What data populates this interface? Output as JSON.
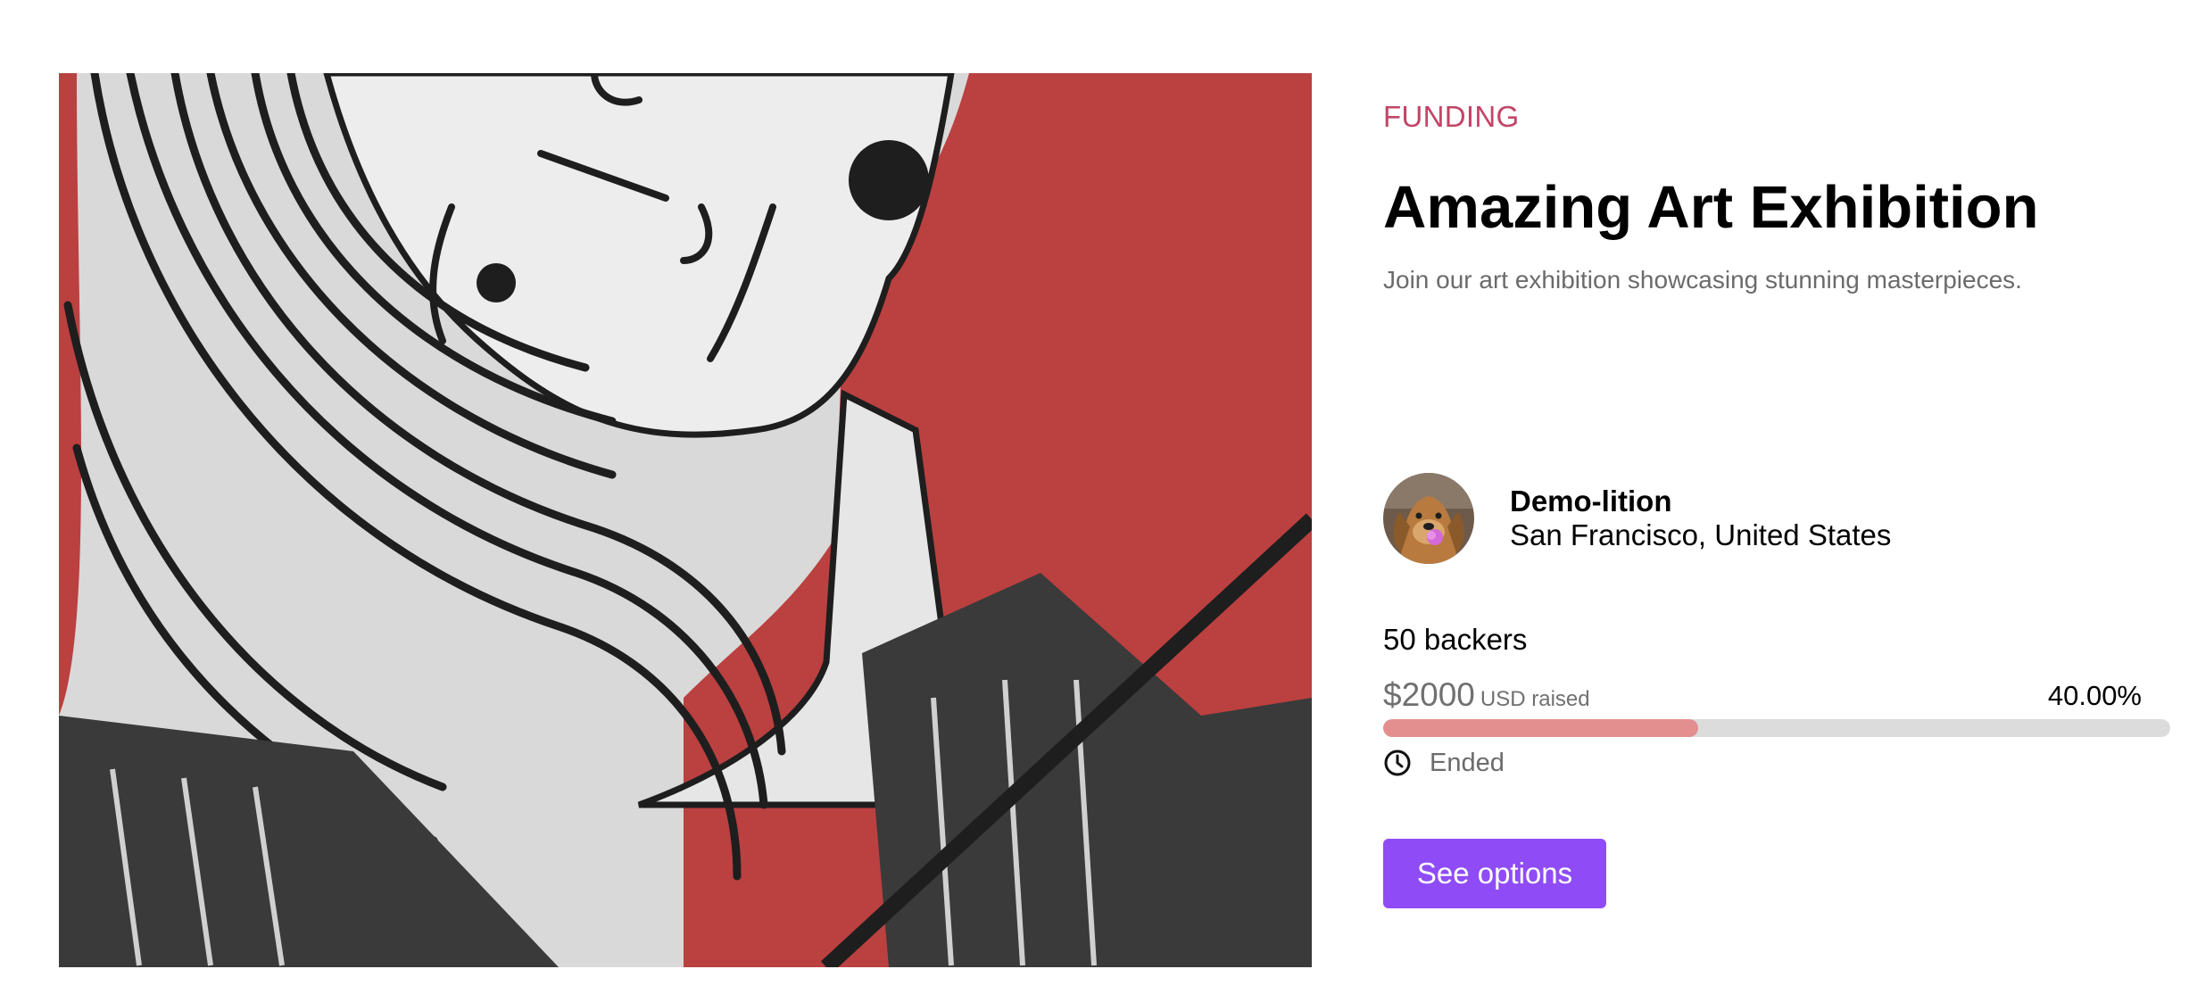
{
  "campaign": {
    "category": "FUNDING",
    "title": "Amazing Art Exhibition",
    "subtitle": "Join our art exhibition showcasing stunning masterpieces.",
    "hero_image_icon": "artwork-image",
    "hero_background_color": "#bb4040"
  },
  "creator": {
    "name": "Demo-lition",
    "location": "San Francisco, United States",
    "avatar_icon": "dog-avatar"
  },
  "stats": {
    "backers": "50 backers",
    "amount": "$2000",
    "amount_suffix": "USD raised",
    "percent_label": "40.00%",
    "progress_fraction": 0.4,
    "status": "Ended",
    "status_icon": "clock-icon"
  },
  "actions": {
    "cta_label": "See options"
  },
  "colors": {
    "category": "#c24566",
    "progress_fill": "#e48f8f",
    "progress_track": "#dcdcdc",
    "cta_background": "#8f4cf6"
  }
}
